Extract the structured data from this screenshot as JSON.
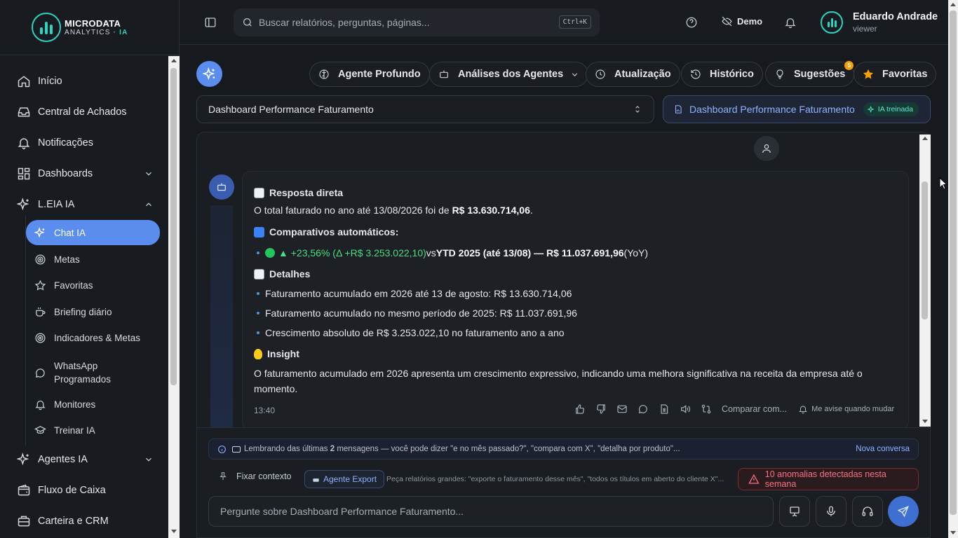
{
  "brand": {
    "line1": "MICRODATA",
    "line2": "ANALYTICS",
    "line2_accent": "· IA"
  },
  "sidebar": {
    "items": [
      {
        "label": "Início",
        "icon": "home-icon"
      },
      {
        "label": "Central de Achados",
        "icon": "inbox-icon"
      },
      {
        "label": "Notificações",
        "icon": "bell-icon"
      },
      {
        "label": "Dashboards",
        "icon": "grid-icon"
      },
      {
        "label": "L.EIA IA",
        "icon": "sparkles-icon"
      },
      {
        "label": "Agentes IA",
        "icon": "sparkles-icon"
      },
      {
        "label": "Fluxo de Caixa",
        "icon": "wallet-icon"
      },
      {
        "label": "Carteira e CRM",
        "icon": "briefcase-icon"
      }
    ],
    "subitems": [
      {
        "label": "Chat IA",
        "icon": "sparkles-icon"
      },
      {
        "label": "Metas",
        "icon": "target-icon"
      },
      {
        "label": "Favoritas",
        "icon": "star-icon"
      },
      {
        "label": "Briefing diário",
        "icon": "coffee-icon"
      },
      {
        "label": "Indicadores & Metas",
        "icon": "target-icon"
      },
      {
        "label": "WhatsApp Programados",
        "icon": "chat-icon"
      },
      {
        "label": "Monitores",
        "icon": "bell-icon"
      },
      {
        "label": "Treinar IA",
        "icon": "graduation-cap-icon"
      }
    ]
  },
  "topbar": {
    "search_placeholder": "Buscar relatórios, perguntas, páginas...",
    "shortcut": "Ctrl+K",
    "demo_label": "Demo",
    "user_name": "Eduardo Andrade",
    "user_role": "viewer"
  },
  "toolbar": {
    "agente_profundo": "Agente Profundo",
    "analises_agentes": "Análises dos Agentes",
    "atualizacao": "Atualização",
    "historico": "Histórico",
    "sugestoes": "Sugestões",
    "sugestoes_count": "5",
    "favoritas": "Favoritas"
  },
  "context": {
    "selected_dashboard": "Dashboard Performance Faturamento",
    "active_dashboard": "Dashboard Performance Faturamento",
    "ia_badge": "IA treinada"
  },
  "message": {
    "h1": "Resposta direta",
    "p1_pre": "O total faturado no ano até 13/08/2026 foi de ",
    "p1_value": "R$ 13.630.714,06",
    "p1_post": ".",
    "h2": "Comparativos automáticos:",
    "cmp_growth": "▲ +23,56% (Δ +R$ 3.253.022,10)",
    "cmp_vs": " vs ",
    "cmp_ref": "YTD 2025 (até 13/08) — R$ 11.037.691,96",
    "cmp_tag": " (YoY)",
    "h3": "Detalhes",
    "details": [
      "Faturamento acumulado em 2026 até 13 de agosto: R$ 13.630.714,06",
      "Faturamento acumulado no mesmo período de 2025: R$ 11.037.691,96",
      "Crescimento absoluto de R$ 3.253.022,10 no faturamento ano a ano"
    ],
    "h4": "Insight",
    "insight": "O faturamento acumulado em 2026 apresenta um crescimento expressivo, indicando uma melhora significativa na receita da empresa até o momento.",
    "time": "13:40",
    "compare_label": "Comparar com...",
    "notify_label": "Me avise quando mudar"
  },
  "footer": {
    "memory_pre": "Lembrando das últimas ",
    "memory_count": "2",
    "memory_post": " mensagens — você pode dizer \"e no mês passado?\", \"compara com X\", \"detalha por produto\"...",
    "new_chat": "Nova conversa",
    "pin_context": "Fixar contexto",
    "export_agent": "Agente Export",
    "export_hint": "Peça relatórios grandes: \"exporte o faturamento desse mês\", \"todos os títulos em aberto do cliente X\"...",
    "anomalies": "10 anomalias detectadas nesta semana",
    "prompt_placeholder": "Pergunte sobre Dashboard Performance Faturamento..."
  },
  "colors": {
    "accent": "#5b8def",
    "brand": "#2dd4bf",
    "positive": "#4ade80",
    "alert": "#fb7185",
    "badge": "#f59e0b"
  }
}
